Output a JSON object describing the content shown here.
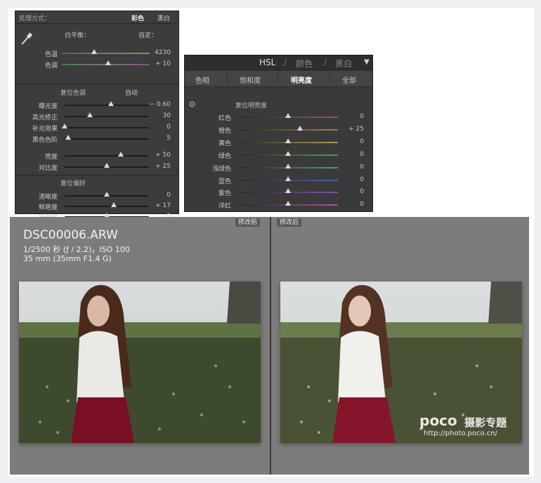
{
  "basic_panel": {
    "treatment_label": "处理方式：",
    "color_option": "彩色",
    "bw_option": "黑白",
    "wb_label": "白平衡：",
    "wb_value": "自定：",
    "wb_sliders": [
      {
        "label": "色温",
        "value": "4230",
        "position": 0.37
      },
      {
        "label": "色调",
        "value": "+ 10",
        "position": 0.53
      }
    ],
    "tone_title": "复位色调",
    "tone_auto": "自动",
    "tone_sliders": [
      {
        "label": "曝光度",
        "value": "− 0.60",
        "position": 0.55
      },
      {
        "label": "高光修正",
        "value": "30",
        "position": 0.3
      },
      {
        "label": "补光效果",
        "value": "0",
        "position": 0.0
      },
      {
        "label": "黑色色阶",
        "value": "5",
        "position": 0.04
      }
    ],
    "tone_sliders2": [
      {
        "label": "亮度",
        "value": "+ 50",
        "position": 0.67
      },
      {
        "label": "对比度",
        "value": "+ 25",
        "position": 0.5
      }
    ],
    "presence_title": "复位偏好",
    "presence_sliders": [
      {
        "label": "清晰度",
        "value": "0",
        "position": 0.5
      },
      {
        "label": "鲜艳度",
        "value": "+ 17",
        "position": 0.58
      },
      {
        "label": "饱和度",
        "value": "0",
        "position": 0.5
      }
    ]
  },
  "hsl_panel": {
    "header": {
      "hsl": "HSL",
      "sep1": "/",
      "color": "颜色",
      "sep2": "/",
      "bw": "黑白",
      "arrow": "▼"
    },
    "tabs": [
      "色相",
      "饱和度",
      "明亮度",
      "全部"
    ],
    "active_tab": 2,
    "reset_title": "复位明亮度",
    "sliders": [
      {
        "label": "红色",
        "value": "0",
        "position": 0.5,
        "color": "#b05050"
      },
      {
        "label": "橙色",
        "value": "+ 25",
        "position": 0.62,
        "color": "#b07a40"
      },
      {
        "label": "黄色",
        "value": "0",
        "position": 0.5,
        "color": "#b0a040"
      },
      {
        "label": "绿色",
        "value": "0",
        "position": 0.5,
        "color": "#50a050"
      },
      {
        "label": "浅绿色",
        "value": "0",
        "position": 0.5,
        "color": "#40a0a0"
      },
      {
        "label": "蓝色",
        "value": "0",
        "position": 0.5,
        "color": "#5060b0"
      },
      {
        "label": "紫色",
        "value": "0",
        "position": 0.5,
        "color": "#8050b0"
      },
      {
        "label": "洋红",
        "value": "0",
        "position": 0.5,
        "color": "#b050a0"
      }
    ]
  },
  "compare_view": {
    "before_tag": "修改前",
    "after_tag": "修改后",
    "filename": "DSC00006.ARW",
    "exposure": "1/2500 秒 (ƒ / 2.2)，ISO 100",
    "lens": "35 mm (35mm F1.4 G)",
    "watermark_brand": "poco",
    "watermark_title": "摄影专题",
    "watermark_url": "http://photo.poco.cn/"
  }
}
